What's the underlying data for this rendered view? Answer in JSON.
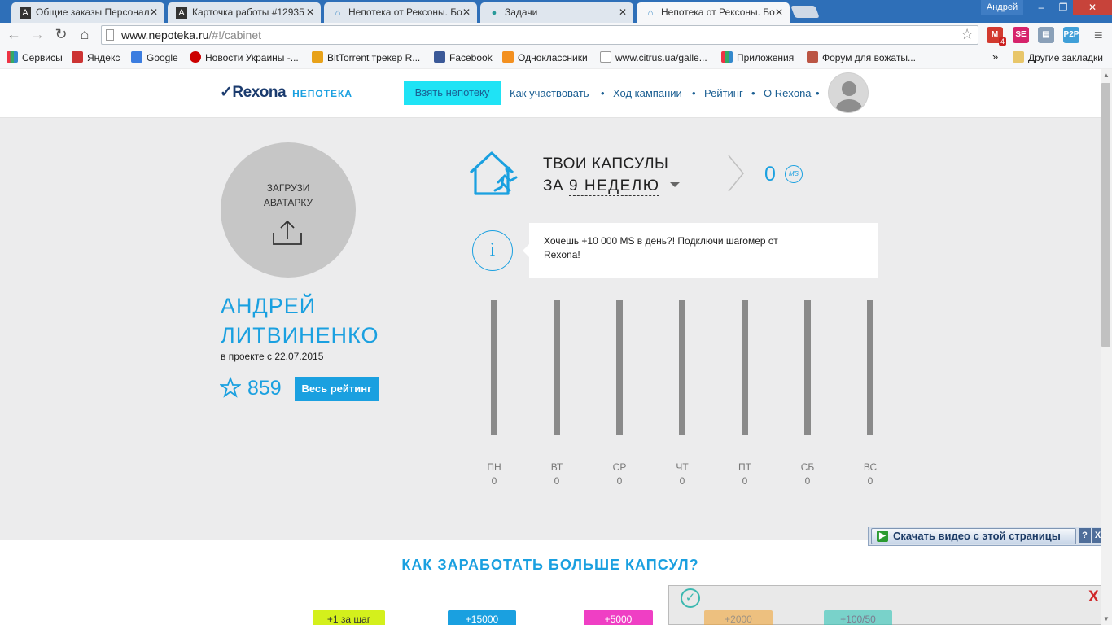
{
  "browser": {
    "tabs": [
      {
        "label": "Общие заказы Персонал",
        "icon": "A"
      },
      {
        "label": "Карточка работы #12935",
        "icon": "A"
      },
      {
        "label": "Непотека от Рексоны. Бо",
        "icon": "⌂"
      },
      {
        "label": "Задачи",
        "icon": "●"
      },
      {
        "label": "Непотека от Рексоны. Бо",
        "icon": "⌂"
      }
    ],
    "user": "Андрей",
    "url": "www.nepoteka.ru",
    "url_path": "/#!/cabinet",
    "mail_badge": "4",
    "bookmarks": [
      "Сервисы",
      "Яндекс",
      "Google",
      "Новости Украины -...",
      "BitTorrent трекер R...",
      "Facebook",
      "Одноклассники",
      "www.citrus.ua/galle...",
      "Приложения",
      "Форум для вожаты..."
    ],
    "bookmarks_more": "»",
    "other_bookmarks": "Другие закладки"
  },
  "site": {
    "logo_brand": "Rexona",
    "logo_product": "НЕПОТЕКА",
    "cta": "Взять непотеку",
    "nav": [
      "Как участвовать",
      "Ход кампании",
      "Рейтинг",
      "О Rexona"
    ],
    "nav_sep": "•"
  },
  "profile": {
    "avatar_upload": "ЗАГРУЗИ\nАВАТАРКУ",
    "first_name": "АНДРЕЙ",
    "last_name": "ЛИТВИНЕНКО",
    "since": "в проекте с 22.07.2015",
    "rating": "859",
    "rating_button": "Весь рейтинг"
  },
  "capsules": {
    "title_line1": "ТВОИ КАПСУЛЫ",
    "title_line2_prefix": "ЗА",
    "week": "9 НЕДЕЛЮ",
    "total": "0",
    "unit": "MS",
    "tip": "Хочешь +10 000 MS в день?! Подключи шагомер от Rexona!",
    "tip_icon": "i"
  },
  "chart_data": {
    "type": "bar",
    "categories": [
      "ПН",
      "ВТ",
      "СР",
      "ЧТ",
      "ПТ",
      "СБ",
      "ВС"
    ],
    "values": [
      0,
      0,
      0,
      0,
      0,
      0,
      0
    ]
  },
  "earn": {
    "title": "КАК ЗАРАБОТАТЬ БОЛЬШЕ КАПСУЛ?",
    "chips": [
      "+1 за шаг",
      "+15000",
      "+5000",
      "+2000",
      "+100/50"
    ]
  },
  "overlay": {
    "download_video": "Скачать видео с этой страницы",
    "help": "?",
    "close": "X",
    "notify_close": "X"
  },
  "colors": {
    "accent": "#1aa0e0",
    "cta_bg": "#1fe3f5",
    "nav_text": "#1a5e92",
    "chrome_blue": "#2e6fb8"
  }
}
